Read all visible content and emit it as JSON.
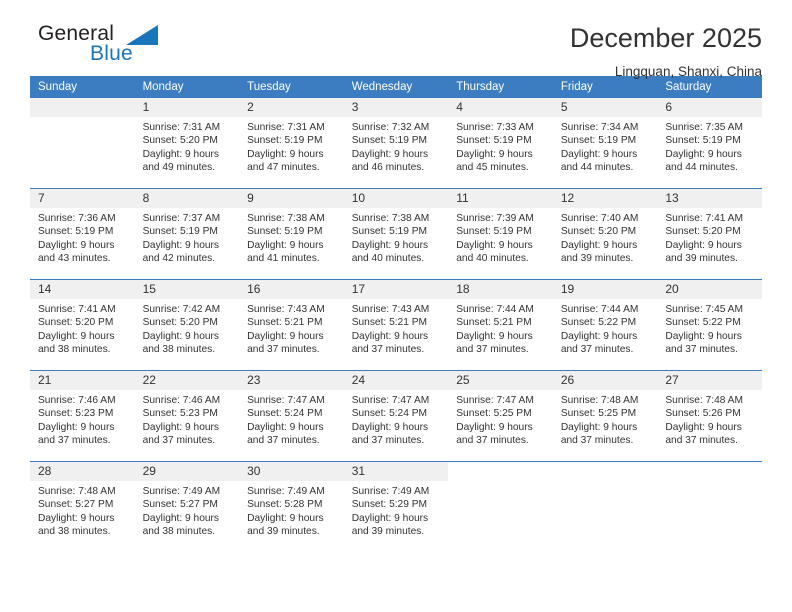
{
  "brand": {
    "word1": "General",
    "word2": "Blue",
    "color": "#1b75bb",
    "triangle_icon": "brand-triangle-icon"
  },
  "header": {
    "title": "December 2025",
    "subtitle": "Lingquan, Shanxi, China"
  },
  "theme": {
    "header_bg": "#3b7dc0",
    "daynum_bg": "#f0f0f0",
    "text": "#333333",
    "separator": "#3b7dc0"
  },
  "weekdays": [
    "Sunday",
    "Monday",
    "Tuesday",
    "Wednesday",
    "Thursday",
    "Friday",
    "Saturday"
  ],
  "weeks": [
    [
      {
        "day": "",
        "lines": []
      },
      {
        "day": "1",
        "lines": [
          "Sunrise: 7:31 AM",
          "Sunset: 5:20 PM",
          "Daylight: 9 hours",
          "and 49 minutes."
        ]
      },
      {
        "day": "2",
        "lines": [
          "Sunrise: 7:31 AM",
          "Sunset: 5:19 PM",
          "Daylight: 9 hours",
          "and 47 minutes."
        ]
      },
      {
        "day": "3",
        "lines": [
          "Sunrise: 7:32 AM",
          "Sunset: 5:19 PM",
          "Daylight: 9 hours",
          "and 46 minutes."
        ]
      },
      {
        "day": "4",
        "lines": [
          "Sunrise: 7:33 AM",
          "Sunset: 5:19 PM",
          "Daylight: 9 hours",
          "and 45 minutes."
        ]
      },
      {
        "day": "5",
        "lines": [
          "Sunrise: 7:34 AM",
          "Sunset: 5:19 PM",
          "Daylight: 9 hours",
          "and 44 minutes."
        ]
      },
      {
        "day": "6",
        "lines": [
          "Sunrise: 7:35 AM",
          "Sunset: 5:19 PM",
          "Daylight: 9 hours",
          "and 44 minutes."
        ]
      }
    ],
    [
      {
        "day": "7",
        "lines": [
          "Sunrise: 7:36 AM",
          "Sunset: 5:19 PM",
          "Daylight: 9 hours",
          "and 43 minutes."
        ]
      },
      {
        "day": "8",
        "lines": [
          "Sunrise: 7:37 AM",
          "Sunset: 5:19 PM",
          "Daylight: 9 hours",
          "and 42 minutes."
        ]
      },
      {
        "day": "9",
        "lines": [
          "Sunrise: 7:38 AM",
          "Sunset: 5:19 PM",
          "Daylight: 9 hours",
          "and 41 minutes."
        ]
      },
      {
        "day": "10",
        "lines": [
          "Sunrise: 7:38 AM",
          "Sunset: 5:19 PM",
          "Daylight: 9 hours",
          "and 40 minutes."
        ]
      },
      {
        "day": "11",
        "lines": [
          "Sunrise: 7:39 AM",
          "Sunset: 5:19 PM",
          "Daylight: 9 hours",
          "and 40 minutes."
        ]
      },
      {
        "day": "12",
        "lines": [
          "Sunrise: 7:40 AM",
          "Sunset: 5:20 PM",
          "Daylight: 9 hours",
          "and 39 minutes."
        ]
      },
      {
        "day": "13",
        "lines": [
          "Sunrise: 7:41 AM",
          "Sunset: 5:20 PM",
          "Daylight: 9 hours",
          "and 39 minutes."
        ]
      }
    ],
    [
      {
        "day": "14",
        "lines": [
          "Sunrise: 7:41 AM",
          "Sunset: 5:20 PM",
          "Daylight: 9 hours",
          "and 38 minutes."
        ]
      },
      {
        "day": "15",
        "lines": [
          "Sunrise: 7:42 AM",
          "Sunset: 5:20 PM",
          "Daylight: 9 hours",
          "and 38 minutes."
        ]
      },
      {
        "day": "16",
        "lines": [
          "Sunrise: 7:43 AM",
          "Sunset: 5:21 PM",
          "Daylight: 9 hours",
          "and 37 minutes."
        ]
      },
      {
        "day": "17",
        "lines": [
          "Sunrise: 7:43 AM",
          "Sunset: 5:21 PM",
          "Daylight: 9 hours",
          "and 37 minutes."
        ]
      },
      {
        "day": "18",
        "lines": [
          "Sunrise: 7:44 AM",
          "Sunset: 5:21 PM",
          "Daylight: 9 hours",
          "and 37 minutes."
        ]
      },
      {
        "day": "19",
        "lines": [
          "Sunrise: 7:44 AM",
          "Sunset: 5:22 PM",
          "Daylight: 9 hours",
          "and 37 minutes."
        ]
      },
      {
        "day": "20",
        "lines": [
          "Sunrise: 7:45 AM",
          "Sunset: 5:22 PM",
          "Daylight: 9 hours",
          "and 37 minutes."
        ]
      }
    ],
    [
      {
        "day": "21",
        "lines": [
          "Sunrise: 7:46 AM",
          "Sunset: 5:23 PM",
          "Daylight: 9 hours",
          "and 37 minutes."
        ]
      },
      {
        "day": "22",
        "lines": [
          "Sunrise: 7:46 AM",
          "Sunset: 5:23 PM",
          "Daylight: 9 hours",
          "and 37 minutes."
        ]
      },
      {
        "day": "23",
        "lines": [
          "Sunrise: 7:47 AM",
          "Sunset: 5:24 PM",
          "Daylight: 9 hours",
          "and 37 minutes."
        ]
      },
      {
        "day": "24",
        "lines": [
          "Sunrise: 7:47 AM",
          "Sunset: 5:24 PM",
          "Daylight: 9 hours",
          "and 37 minutes."
        ]
      },
      {
        "day": "25",
        "lines": [
          "Sunrise: 7:47 AM",
          "Sunset: 5:25 PM",
          "Daylight: 9 hours",
          "and 37 minutes."
        ]
      },
      {
        "day": "26",
        "lines": [
          "Sunrise: 7:48 AM",
          "Sunset: 5:25 PM",
          "Daylight: 9 hours",
          "and 37 minutes."
        ]
      },
      {
        "day": "27",
        "lines": [
          "Sunrise: 7:48 AM",
          "Sunset: 5:26 PM",
          "Daylight: 9 hours",
          "and 37 minutes."
        ]
      }
    ],
    [
      {
        "day": "28",
        "lines": [
          "Sunrise: 7:48 AM",
          "Sunset: 5:27 PM",
          "Daylight: 9 hours",
          "and 38 minutes."
        ]
      },
      {
        "day": "29",
        "lines": [
          "Sunrise: 7:49 AM",
          "Sunset: 5:27 PM",
          "Daylight: 9 hours",
          "and 38 minutes."
        ]
      },
      {
        "day": "30",
        "lines": [
          "Sunrise: 7:49 AM",
          "Sunset: 5:28 PM",
          "Daylight: 9 hours",
          "and 39 minutes."
        ]
      },
      {
        "day": "31",
        "lines": [
          "Sunrise: 7:49 AM",
          "Sunset: 5:29 PM",
          "Daylight: 9 hours",
          "and 39 minutes."
        ]
      },
      {
        "day": "",
        "lines": []
      },
      {
        "day": "",
        "lines": []
      },
      {
        "day": "",
        "lines": []
      }
    ]
  ]
}
